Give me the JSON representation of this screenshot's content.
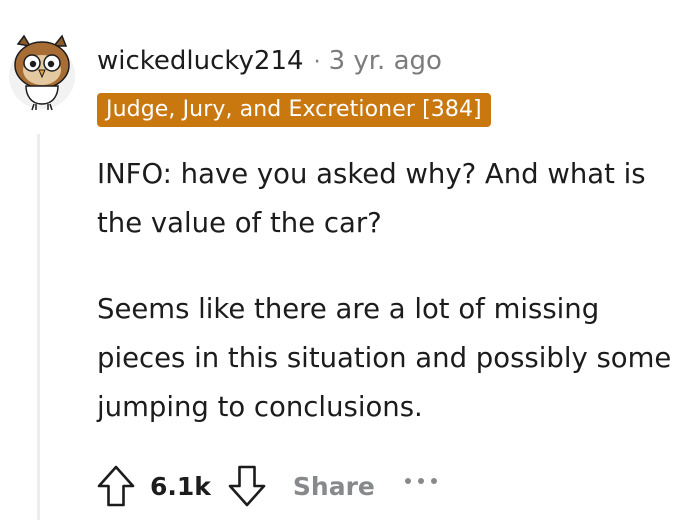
{
  "comment": {
    "author": "wickedlucky214",
    "separator": "·",
    "age": "3 yr. ago",
    "flair": "Judge, Jury, and Excretioner [384]",
    "paragraphs": [
      "INFO: have you asked why? And what is the value of the car?",
      "Seems like there are a lot of missing pieces in this situation and possibly some jumping to conclusions."
    ],
    "score": "6.1k",
    "share_label": "Share"
  },
  "colors": {
    "flair_background": "#c8780f",
    "meta_text": "#7c7c7c",
    "share_text": "#878a8c",
    "thread_line": "#ededed"
  },
  "icons": {
    "avatar": "owl-avatar-icon",
    "upvote": "upvote-arrow-icon",
    "downvote": "downvote-arrow-icon",
    "more": "more-options-icon"
  }
}
